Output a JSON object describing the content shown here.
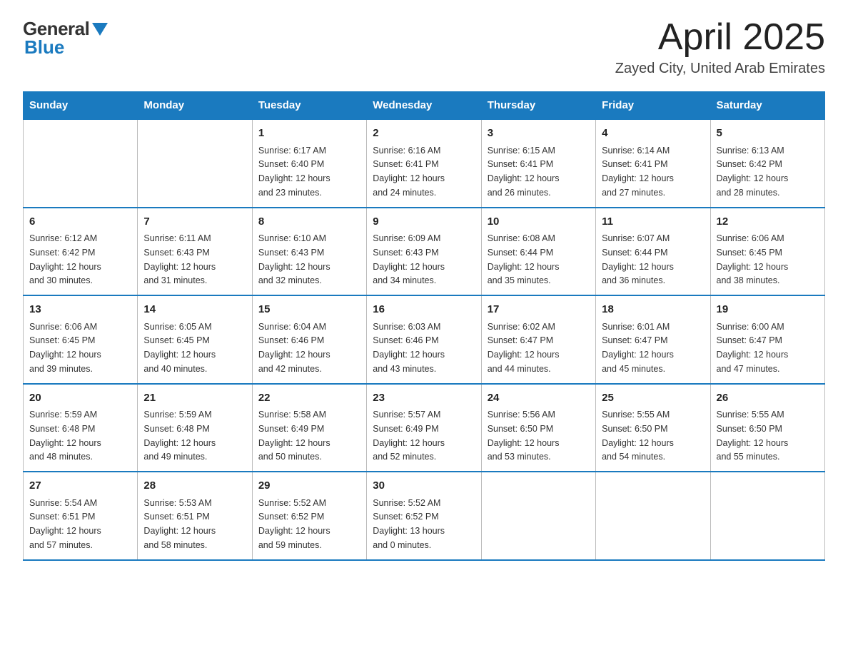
{
  "header": {
    "logo_text_general": "General",
    "logo_text_blue": "Blue",
    "month_title": "April 2025",
    "location": "Zayed City, United Arab Emirates"
  },
  "calendar": {
    "days_of_week": [
      "Sunday",
      "Monday",
      "Tuesday",
      "Wednesday",
      "Thursday",
      "Friday",
      "Saturday"
    ],
    "weeks": [
      [
        {
          "day": "",
          "info": ""
        },
        {
          "day": "",
          "info": ""
        },
        {
          "day": "1",
          "info": "Sunrise: 6:17 AM\nSunset: 6:40 PM\nDaylight: 12 hours\nand 23 minutes."
        },
        {
          "day": "2",
          "info": "Sunrise: 6:16 AM\nSunset: 6:41 PM\nDaylight: 12 hours\nand 24 minutes."
        },
        {
          "day": "3",
          "info": "Sunrise: 6:15 AM\nSunset: 6:41 PM\nDaylight: 12 hours\nand 26 minutes."
        },
        {
          "day": "4",
          "info": "Sunrise: 6:14 AM\nSunset: 6:41 PM\nDaylight: 12 hours\nand 27 minutes."
        },
        {
          "day": "5",
          "info": "Sunrise: 6:13 AM\nSunset: 6:42 PM\nDaylight: 12 hours\nand 28 minutes."
        }
      ],
      [
        {
          "day": "6",
          "info": "Sunrise: 6:12 AM\nSunset: 6:42 PM\nDaylight: 12 hours\nand 30 minutes."
        },
        {
          "day": "7",
          "info": "Sunrise: 6:11 AM\nSunset: 6:43 PM\nDaylight: 12 hours\nand 31 minutes."
        },
        {
          "day": "8",
          "info": "Sunrise: 6:10 AM\nSunset: 6:43 PM\nDaylight: 12 hours\nand 32 minutes."
        },
        {
          "day": "9",
          "info": "Sunrise: 6:09 AM\nSunset: 6:43 PM\nDaylight: 12 hours\nand 34 minutes."
        },
        {
          "day": "10",
          "info": "Sunrise: 6:08 AM\nSunset: 6:44 PM\nDaylight: 12 hours\nand 35 minutes."
        },
        {
          "day": "11",
          "info": "Sunrise: 6:07 AM\nSunset: 6:44 PM\nDaylight: 12 hours\nand 36 minutes."
        },
        {
          "day": "12",
          "info": "Sunrise: 6:06 AM\nSunset: 6:45 PM\nDaylight: 12 hours\nand 38 minutes."
        }
      ],
      [
        {
          "day": "13",
          "info": "Sunrise: 6:06 AM\nSunset: 6:45 PM\nDaylight: 12 hours\nand 39 minutes."
        },
        {
          "day": "14",
          "info": "Sunrise: 6:05 AM\nSunset: 6:45 PM\nDaylight: 12 hours\nand 40 minutes."
        },
        {
          "day": "15",
          "info": "Sunrise: 6:04 AM\nSunset: 6:46 PM\nDaylight: 12 hours\nand 42 minutes."
        },
        {
          "day": "16",
          "info": "Sunrise: 6:03 AM\nSunset: 6:46 PM\nDaylight: 12 hours\nand 43 minutes."
        },
        {
          "day": "17",
          "info": "Sunrise: 6:02 AM\nSunset: 6:47 PM\nDaylight: 12 hours\nand 44 minutes."
        },
        {
          "day": "18",
          "info": "Sunrise: 6:01 AM\nSunset: 6:47 PM\nDaylight: 12 hours\nand 45 minutes."
        },
        {
          "day": "19",
          "info": "Sunrise: 6:00 AM\nSunset: 6:47 PM\nDaylight: 12 hours\nand 47 minutes."
        }
      ],
      [
        {
          "day": "20",
          "info": "Sunrise: 5:59 AM\nSunset: 6:48 PM\nDaylight: 12 hours\nand 48 minutes."
        },
        {
          "day": "21",
          "info": "Sunrise: 5:59 AM\nSunset: 6:48 PM\nDaylight: 12 hours\nand 49 minutes."
        },
        {
          "day": "22",
          "info": "Sunrise: 5:58 AM\nSunset: 6:49 PM\nDaylight: 12 hours\nand 50 minutes."
        },
        {
          "day": "23",
          "info": "Sunrise: 5:57 AM\nSunset: 6:49 PM\nDaylight: 12 hours\nand 52 minutes."
        },
        {
          "day": "24",
          "info": "Sunrise: 5:56 AM\nSunset: 6:50 PM\nDaylight: 12 hours\nand 53 minutes."
        },
        {
          "day": "25",
          "info": "Sunrise: 5:55 AM\nSunset: 6:50 PM\nDaylight: 12 hours\nand 54 minutes."
        },
        {
          "day": "26",
          "info": "Sunrise: 5:55 AM\nSunset: 6:50 PM\nDaylight: 12 hours\nand 55 minutes."
        }
      ],
      [
        {
          "day": "27",
          "info": "Sunrise: 5:54 AM\nSunset: 6:51 PM\nDaylight: 12 hours\nand 57 minutes."
        },
        {
          "day": "28",
          "info": "Sunrise: 5:53 AM\nSunset: 6:51 PM\nDaylight: 12 hours\nand 58 minutes."
        },
        {
          "day": "29",
          "info": "Sunrise: 5:52 AM\nSunset: 6:52 PM\nDaylight: 12 hours\nand 59 minutes."
        },
        {
          "day": "30",
          "info": "Sunrise: 5:52 AM\nSunset: 6:52 PM\nDaylight: 13 hours\nand 0 minutes."
        },
        {
          "day": "",
          "info": ""
        },
        {
          "day": "",
          "info": ""
        },
        {
          "day": "",
          "info": ""
        }
      ]
    ]
  }
}
